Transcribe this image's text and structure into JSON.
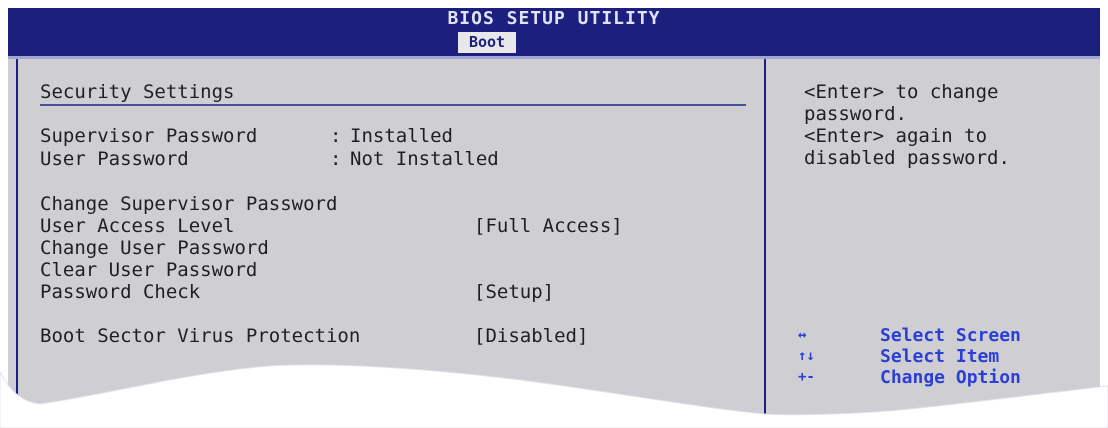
{
  "header": {
    "title": "BIOS SETUP UTILITY",
    "active_tab": "Boot"
  },
  "settings": {
    "section_title": "Security Settings",
    "status": [
      {
        "label": "Supervisor Password",
        "colon": ":",
        "value": "Installed"
      },
      {
        "label": "User Password",
        "colon": ":",
        "value": "Not Installed"
      }
    ],
    "items": [
      {
        "label": "Change Supervisor Password",
        "value": ""
      },
      {
        "label": "User Access Level",
        "value": "[Full Access]"
      },
      {
        "label": "Change User Password",
        "value": ""
      },
      {
        "label": "Clear User Password",
        "value": ""
      },
      {
        "label": "Password Check",
        "value": "[Setup]"
      },
      {
        "label": "Boot Sector Virus Protection",
        "value": "[Disabled]"
      }
    ]
  },
  "help": {
    "text": "<Enter> to change\npassword.\n<Enter> again to\ndisabled password."
  },
  "keys": [
    {
      "symbol": "↔",
      "icon": "left-right-arrow-icon",
      "label": "Select Screen"
    },
    {
      "symbol": "↑↓",
      "icon": "up-down-arrow-icon",
      "label": "Select Item"
    },
    {
      "symbol": "+-",
      "icon": "plus-minus-icon",
      "label": "Change Option"
    }
  ],
  "colors": {
    "header_bg": "#1c1f7e",
    "panel_bg": "#cfcfd3",
    "key_text": "#2b3fd6",
    "body_text": "#1e1e24"
  }
}
